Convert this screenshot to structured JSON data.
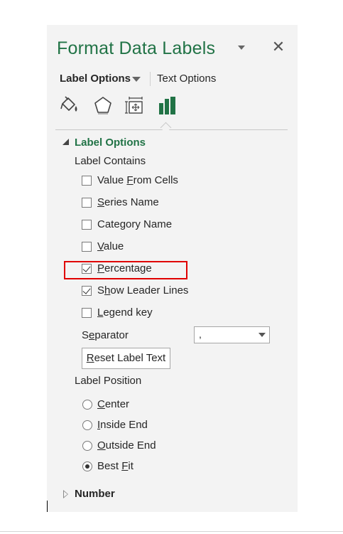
{
  "pane": {
    "title": "Format Data Labels",
    "close_glyph": "✕",
    "tabs": [
      {
        "label": "Label Options",
        "selected": true
      },
      {
        "label": "Text Options",
        "selected": false
      }
    ],
    "icons": [
      "fill-line-icon",
      "effects-pentagon-icon",
      "size-properties-icon",
      "series-options-chart-icon"
    ]
  },
  "label_options": {
    "section_title": "Label Options",
    "contains_label": "Label Contains",
    "checkboxes": [
      {
        "pre": "Value ",
        "key": "F",
        "post": "rom Cells",
        "checked": false
      },
      {
        "pre": "",
        "key": "S",
        "post": "eries Name",
        "checked": false
      },
      {
        "pre": "Cate",
        "key": "g",
        "post": "ory Name",
        "checked": false
      },
      {
        "pre": "",
        "key": "V",
        "post": "alue",
        "checked": false
      },
      {
        "pre": "",
        "key": "P",
        "post": "ercentage",
        "checked": true
      },
      {
        "pre": "S",
        "key": "h",
        "post": "ow Leader Lines",
        "checked": true
      },
      {
        "pre": "",
        "key": "L",
        "post": "egend key",
        "checked": false
      }
    ],
    "separator": {
      "pre": "S",
      "key": "e",
      "post": "parator",
      "value": ","
    },
    "reset_button": {
      "pre": "",
      "key": "R",
      "post": "eset Label Text"
    },
    "position_label": "Label Position",
    "positions": [
      {
        "pre": "",
        "key": "C",
        "post": "enter",
        "selected": false
      },
      {
        "pre": "",
        "key": "I",
        "post": "nside End",
        "selected": false
      },
      {
        "pre": "",
        "key": "O",
        "post": "utside End",
        "selected": false
      },
      {
        "pre": "Best ",
        "key": "F",
        "post": "it",
        "selected": true
      }
    ]
  },
  "number_section": {
    "title": "Number"
  },
  "colors": {
    "accent_green": "#217346",
    "highlight_red": "#e00000",
    "pane_bg": "#f3f3f3"
  }
}
